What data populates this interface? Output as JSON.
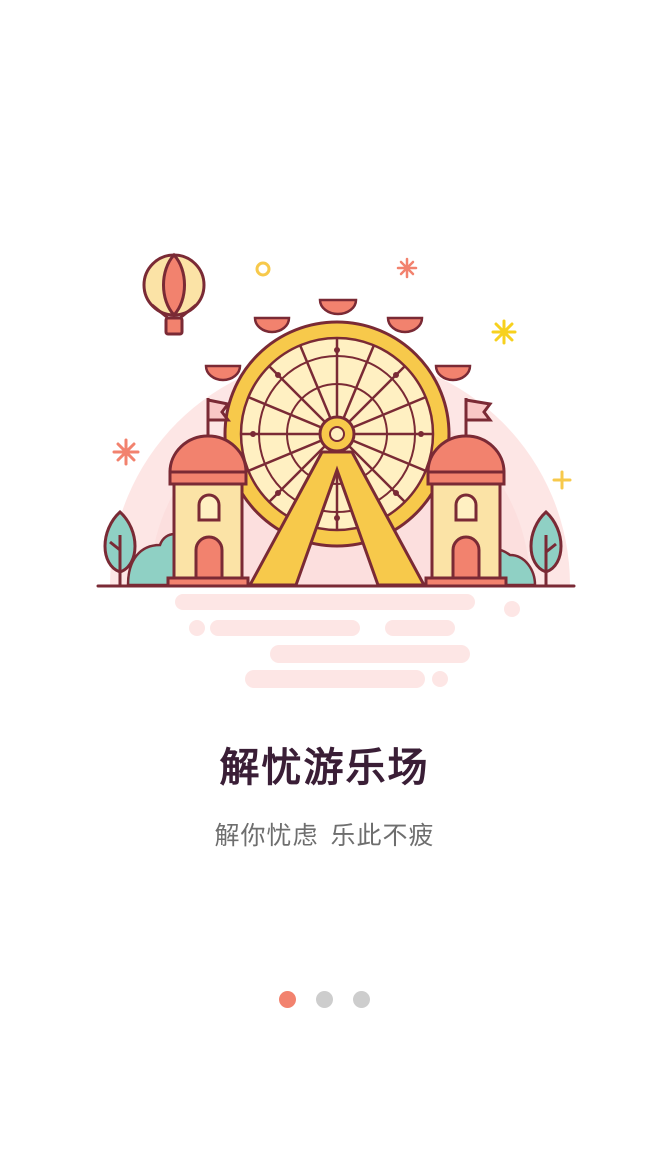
{
  "onboarding": {
    "title": "解忧游乐场",
    "subtitle_part1": "解你忧虑",
    "subtitle_part2": "乐此不疲"
  },
  "pager": {
    "total": 3,
    "active_index": 0,
    "active_color": "#f2826e",
    "inactive_color": "#cdcdcd"
  },
  "illustration": {
    "icons": [
      "ferris-wheel-icon",
      "hot-air-balloon-icon",
      "castle-tower-icon",
      "tree-icon",
      "sparkle-icon",
      "pinwheel-flower-icon"
    ]
  },
  "colors": {
    "title": "#3a1e36",
    "subtitle": "#6e6e6e",
    "outline": "#7a2a35",
    "yellow": "#f7c94b",
    "light_yellow": "#fff0c2",
    "coral": "#f2826e",
    "pink_bg": "#fde1e1",
    "teal": "#8fd0c4"
  }
}
